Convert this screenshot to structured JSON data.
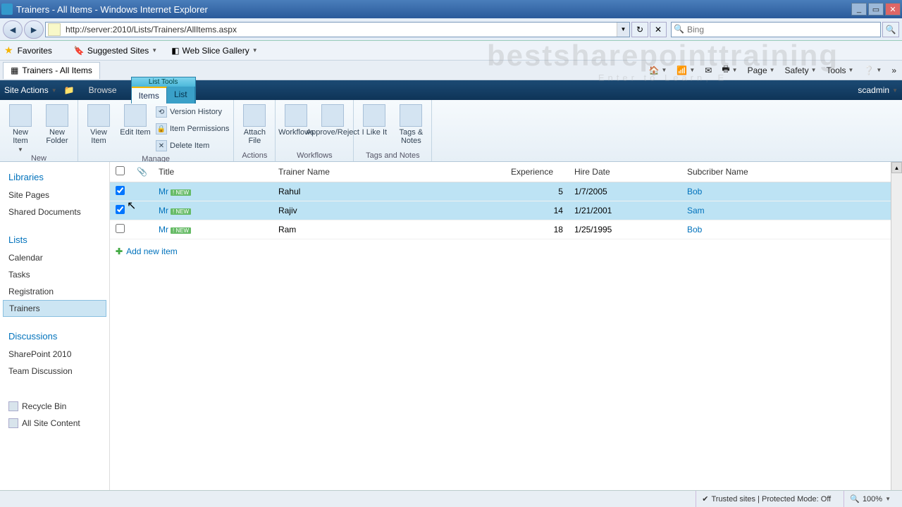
{
  "window": {
    "title": "Trainers - All Items - Windows Internet Explorer"
  },
  "address": {
    "url": "http://server:2010/Lists/Trainers/AllItems.aspx"
  },
  "search": {
    "placeholder": "Bing"
  },
  "favbar": {
    "favorites": "Favorites",
    "suggested": "Suggested Sites",
    "slice": "Web Slice Gallery"
  },
  "tab": {
    "title": "Trainers - All Items"
  },
  "cmdbar": {
    "page": "Page",
    "safety": "Safety",
    "tools": "Tools"
  },
  "sptop": {
    "site_actions": "Site Actions",
    "browse": "Browse",
    "list_tools": "List Tools",
    "items": "Items",
    "list": "List",
    "user": "scadmin"
  },
  "ribbon": {
    "new_item": "New Item",
    "new_folder": "New Folder",
    "view_item": "View Item",
    "edit_item": "Edit Item",
    "version_history": "Version History",
    "item_permissions": "Item Permissions",
    "delete_item": "Delete Item",
    "attach_file": "Attach File",
    "workflows": "Workflows",
    "approve_reject": "Approve/Reject",
    "i_like_it": "I Like It",
    "tags_notes": "Tags & Notes",
    "g_new": "New",
    "g_manage": "Manage",
    "g_actions": "Actions",
    "g_workflows": "Workflows",
    "g_tags": "Tags and Notes"
  },
  "leftnav": {
    "libraries": "Libraries",
    "site_pages": "Site Pages",
    "shared_documents": "Shared Documents",
    "lists": "Lists",
    "calendar": "Calendar",
    "tasks": "Tasks",
    "registration": "Registration",
    "trainers": "Trainers",
    "discussions": "Discussions",
    "sp2010": "SharePoint 2010",
    "team_discussion": "Team Discussion",
    "recycle_bin": "Recycle Bin",
    "all_site_content": "All Site Content"
  },
  "columns": {
    "title": "Title",
    "trainer": "Trainer Name",
    "experience": "Experience",
    "hire_date": "Hire Date",
    "subscriber": "Subcriber Name"
  },
  "rows": [
    {
      "checked": true,
      "title": "Mr",
      "new": true,
      "trainer": "Rahul",
      "experience": "5",
      "hire_date": "1/7/2005",
      "subscriber": "Bob"
    },
    {
      "checked": true,
      "title": "Mr",
      "new": true,
      "trainer": "Rajiv",
      "experience": "14",
      "hire_date": "1/21/2001",
      "subscriber": "Sam"
    },
    {
      "checked": false,
      "title": "Mr",
      "new": true,
      "trainer": "Ram",
      "experience": "18",
      "hire_date": "1/25/1995",
      "subscriber": "Bob"
    }
  ],
  "addnew": "Add new item",
  "status": {
    "zone": "Trusted sites | Protected Mode: Off",
    "zoom": "100%"
  },
  "watermark": {
    "big": "bestsharepointtraining",
    "sub": "Enter to Learn, E"
  }
}
